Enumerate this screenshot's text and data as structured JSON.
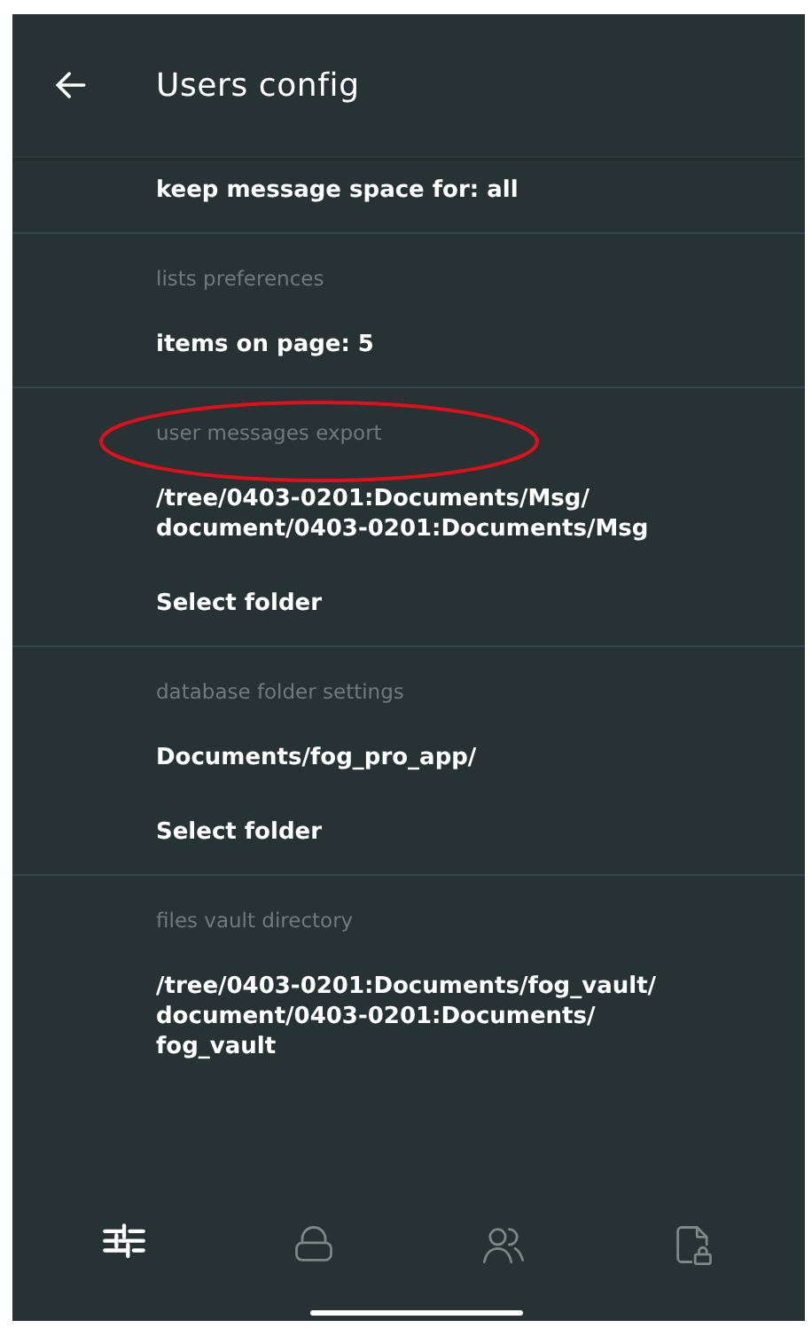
{
  "app_bar": {
    "title": "Users config"
  },
  "sections": [
    {
      "items": [
        {
          "text": "keep message space for: all"
        }
      ]
    },
    {
      "header": "lists preferences",
      "items": [
        {
          "text": "items on page: 5"
        }
      ]
    },
    {
      "header": "user messages export",
      "highlighted": true,
      "items": [
        {
          "text": "/tree/0403-0201:Documents/Msg/\ndocument/0403-0201:Documents/Msg"
        },
        {
          "text": "Select folder"
        }
      ]
    },
    {
      "header": "database folder settings",
      "items": [
        {
          "text": "Documents/fog_pro_app/"
        },
        {
          "text": "Select folder"
        }
      ]
    },
    {
      "header": "files vault directory",
      "items": [
        {
          "text": "/tree/0403-0201:Documents/fog_vault/\ndocument/0403-0201:Documents/\nfog_vault"
        }
      ]
    }
  ],
  "bottom_nav": [
    {
      "selected": true
    },
    {
      "selected": false
    },
    {
      "selected": false
    },
    {
      "selected": false
    }
  ]
}
